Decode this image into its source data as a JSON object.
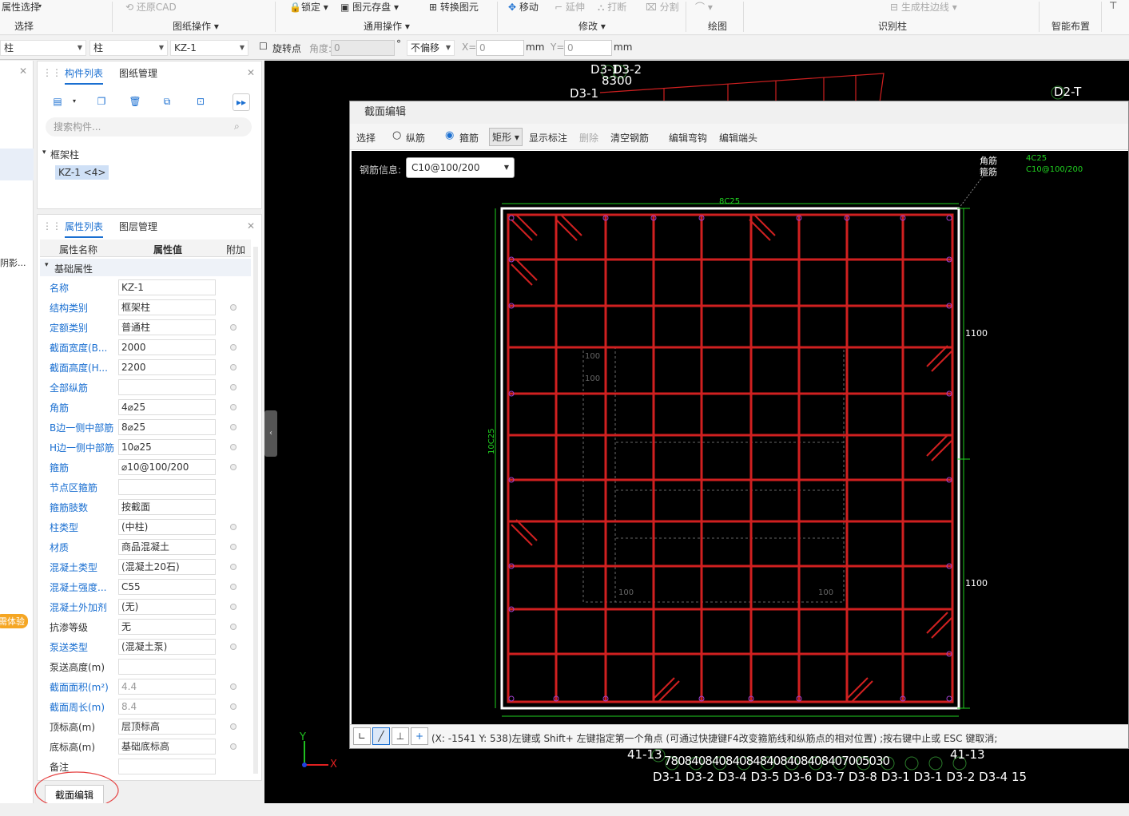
{
  "ribbon": {
    "items": [
      "属性选择",
      "还原CAD",
      "锁定",
      "图元存盘",
      "转换图元",
      "移动",
      "延伸",
      "打断",
      "分割",
      "生成柱边线",
      "智能布置"
    ],
    "groups": [
      "选择",
      "图纸操作",
      "通用操作",
      "修改",
      "绘图",
      "识别柱",
      "智能布置"
    ]
  },
  "filter": {
    "floor": "柱",
    "type": "柱",
    "component": "KZ-1",
    "rotate_point": "旋转点",
    "angle_label": "角度:",
    "angle_value": "0",
    "offset": "不偏移",
    "x_label": "X=",
    "x_value": "0",
    "y_label": "Y=",
    "y_value": "0",
    "unit": "mm"
  },
  "left_strip": {
    "text1": "阴影...",
    "badge": "需体验"
  },
  "component_panel": {
    "tabs": [
      "构件列表",
      "图纸管理"
    ],
    "search_placeholder": "搜索构件...",
    "tree_parent": "框架柱",
    "tree_child": "KZ-1 <4>"
  },
  "property_panel": {
    "tabs": [
      "属性列表",
      "图层管理"
    ],
    "headers": [
      "属性名称",
      "属性值",
      "附加"
    ],
    "group": "基础属性",
    "rows": [
      {
        "name": "名称",
        "value": "KZ-1"
      },
      {
        "name": "结构类别",
        "value": "框架柱"
      },
      {
        "name": "定额类别",
        "value": "普通柱"
      },
      {
        "name": "截面宽度(B...",
        "value": "2000"
      },
      {
        "name": "截面高度(H...",
        "value": "2200"
      },
      {
        "name": "全部纵筋",
        "value": ""
      },
      {
        "name": "角筋",
        "value": "4⌀25"
      },
      {
        "name": "B边一侧中部筋",
        "value": "8⌀25"
      },
      {
        "name": "H边一侧中部筋",
        "value": "10⌀25"
      },
      {
        "name": "箍筋",
        "value": "⌀10@100/200"
      },
      {
        "name": "节点区箍筋",
        "value": ""
      },
      {
        "name": "箍筋肢数",
        "value": "按截面"
      },
      {
        "name": "柱类型",
        "value": "(中柱)"
      },
      {
        "name": "材质",
        "value": "商品混凝土"
      },
      {
        "name": "混凝土类型",
        "value": "(混凝土20石)"
      },
      {
        "name": "混凝土强度...",
        "value": "C55"
      },
      {
        "name": "混凝土外加剂",
        "value": "(无)"
      },
      {
        "name": "抗渗等级",
        "value": "无"
      },
      {
        "name": "泵送类型",
        "value": "(混凝土泵)"
      },
      {
        "name": "泵送高度(m)",
        "value": ""
      },
      {
        "name": "截面面积(m²)",
        "value": "4.4"
      },
      {
        "name": "截面周长(m)",
        "value": "8.4"
      },
      {
        "name": "顶标高(m)",
        "value": "层顶标高"
      },
      {
        "name": "底标高(m)",
        "value": "基础底标高"
      },
      {
        "name": "备注",
        "value": ""
      }
    ],
    "section_button": "截面编辑"
  },
  "cad": {
    "labels_top": [
      "D3-1",
      "D3-2",
      "8300",
      "D3-1",
      "D2-T"
    ],
    "labels_bottom": [
      "41-13",
      "78",
      "0840",
      "840",
      "840",
      "84",
      "840",
      "840",
      "840",
      "840",
      "70",
      "0",
      "50",
      "3",
      "0",
      "41-13"
    ],
    "labels_bottom2": "D3-1 D3-2 D3-4 D3-5 D3-6 D3-7 D3-8 D3-1 D3-1 D3-2 D3-4 15",
    "axis_x": "X",
    "axis_y": "Y"
  },
  "dialog": {
    "title": "截面编辑",
    "toolbar": [
      "选择",
      "纵筋",
      "箍筋",
      "矩形",
      "显示标注",
      "删除",
      "清空钢筋",
      "编辑弯钩",
      "编辑端头"
    ],
    "rebar_label": "钢筋信息:",
    "rebar_value": "C10@100/200",
    "legend_corner": "角筋",
    "legend_corner_val": "4C25",
    "legend_stirrup": "箍筋",
    "legend_stirrup_val": "C10@100/200",
    "top_label": "8C25",
    "side_label": "10C25",
    "dim_right1": "1100",
    "dim_right2": "1100",
    "dim_100": "100",
    "status_text": "(X: -1541 Y: 538)左键或 Shift+ 左键指定第一个角点 (可通过快捷键F4改变箍筋线和纵筋点的相对位置) ;按右键中止或 ESC 键取消;"
  }
}
